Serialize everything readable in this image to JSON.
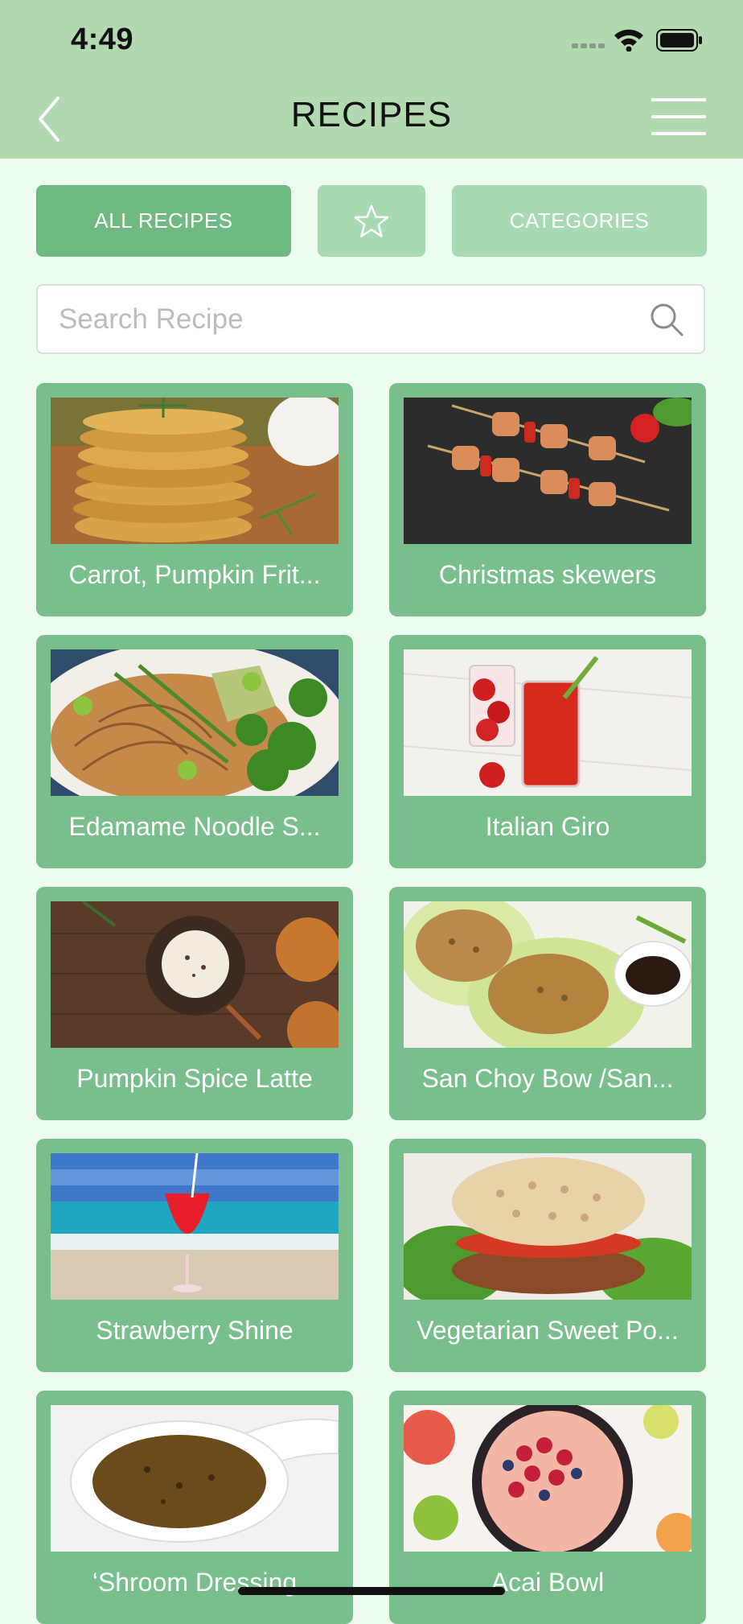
{
  "status_bar": {
    "time": "4:49"
  },
  "header": {
    "title": "RECIPES"
  },
  "tabs": {
    "all_label": "ALL RECIPES",
    "categories_label": "CATEGORIES"
  },
  "search": {
    "placeholder": "Search Recipe"
  },
  "recipes": [
    {
      "name": "Carrot, Pumpkin Frit..."
    },
    {
      "name": "Christmas skewers"
    },
    {
      "name": "Edamame Noodle S..."
    },
    {
      "name": "Italian Giro"
    },
    {
      "name": "Pumpkin Spice Latte"
    },
    {
      "name": "San Choy Bow /San..."
    },
    {
      "name": "Strawberry Shine"
    },
    {
      "name": "Vegetarian Sweet Po..."
    },
    {
      "name": "‘Shroom Dressing"
    },
    {
      "name": "Acai Bowl"
    }
  ],
  "colors": {
    "header": "#b2d9af",
    "background": "#eefbef",
    "card": "#78bf8c",
    "tab_active": "#6fba82",
    "tab_inactive": "#a8dab1"
  }
}
